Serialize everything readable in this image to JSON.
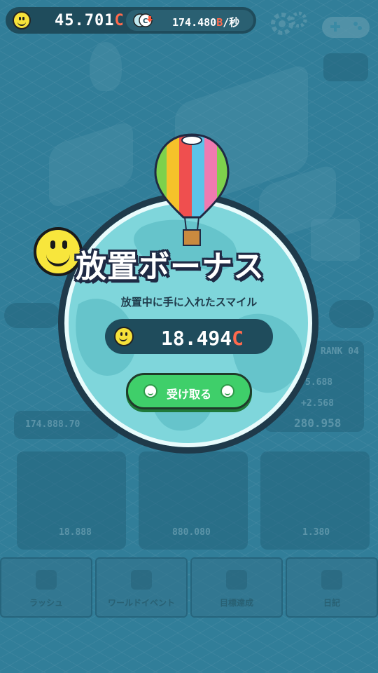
{
  "header": {
    "coins": "45.701",
    "coins_unit": "C",
    "rate_value": "174.480",
    "rate_unit": "B",
    "rate_suffix": "/秒"
  },
  "modal": {
    "title": "放置ボーナス",
    "subtitle": "放置中に手に入れたスマイル",
    "reward_value": "18.494",
    "reward_unit": "C",
    "claim_label": "受け取る"
  },
  "background": {
    "total_text": "174.888.70",
    "cards_right": [
      "RANK 04",
      "5.688",
      "+2.568",
      "280.958"
    ],
    "cards_bottom": [
      "18.888",
      "880.080",
      "1.380"
    ]
  },
  "bottom_nav": {
    "items": [
      {
        "label": "ラッシュ"
      },
      {
        "label": "ワールドイベント"
      },
      {
        "label": "目標達成"
      },
      {
        "label": "日記"
      }
    ]
  },
  "colors": {
    "accent": "#ff6a4d",
    "button": "#3fcf6a",
    "panel": "#1f4c5c",
    "globe": "#7fd6db"
  }
}
